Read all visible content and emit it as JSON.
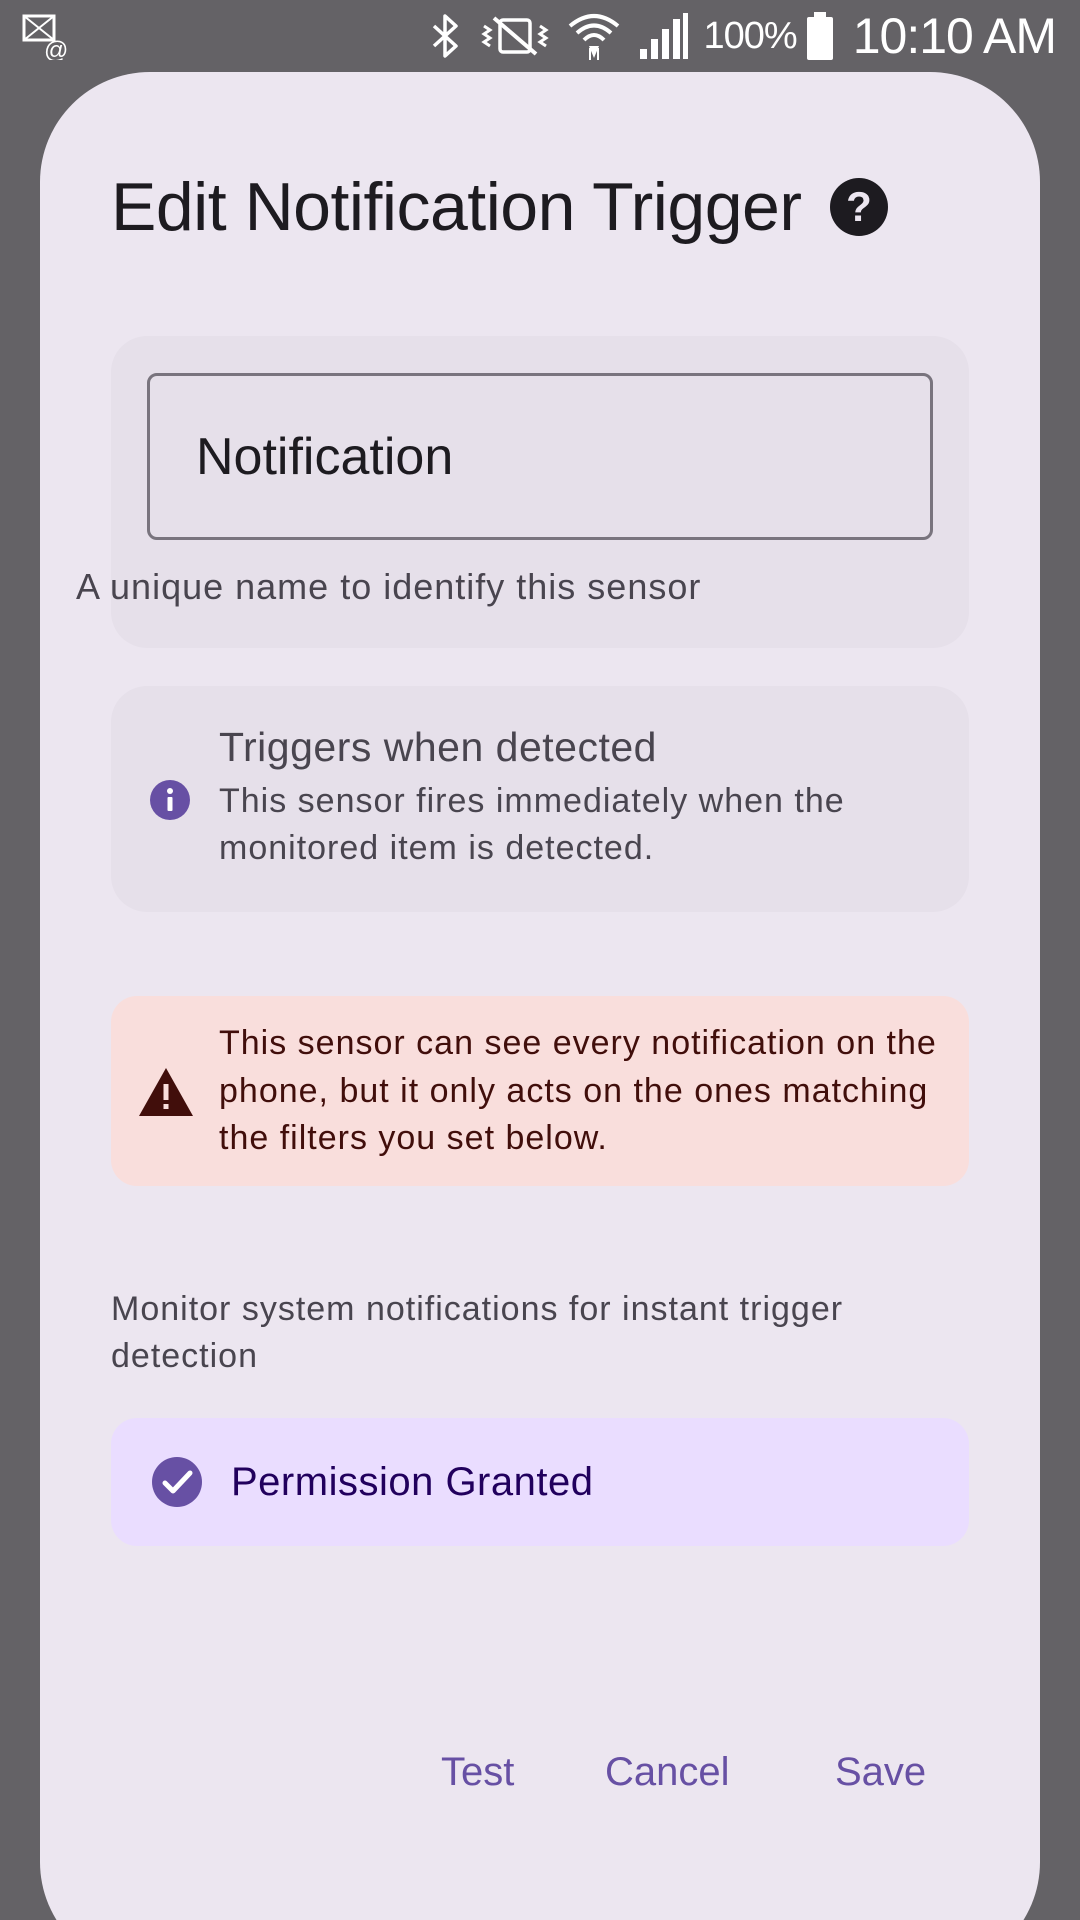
{
  "status_bar": {
    "battery_text": "100%",
    "time": "10:10 AM",
    "icons": [
      "notification-icon",
      "bluetooth-icon",
      "vibrate-icon",
      "wifi-icon",
      "signal-icon",
      "battery-icon"
    ]
  },
  "dialog": {
    "title": "Edit Notification Trigger",
    "name_field": {
      "value": "Notification",
      "helper": "A unique name to identify this sensor"
    },
    "info": {
      "title": "Triggers when detected",
      "body": "This sensor fires immediately when the monitored item is detected."
    },
    "warning": {
      "text": "This sensor can see every notification on the phone, but it only acts on the ones matching the filters you set below."
    },
    "monitor_description": "Monitor system notifications for instant trigger detection",
    "permission": {
      "label": "Permission Granted"
    },
    "actions": {
      "test": "Test",
      "cancel": "Cancel",
      "save": "Save"
    }
  },
  "colors": {
    "scrim": "#646266",
    "dialog_bg": "#ece6f0",
    "card_bg": "#e6e0ea",
    "warning_bg": "#f9dedc",
    "warning_fg": "#410e0b",
    "permission_bg": "#eaddff",
    "accent": "#6750a4"
  }
}
